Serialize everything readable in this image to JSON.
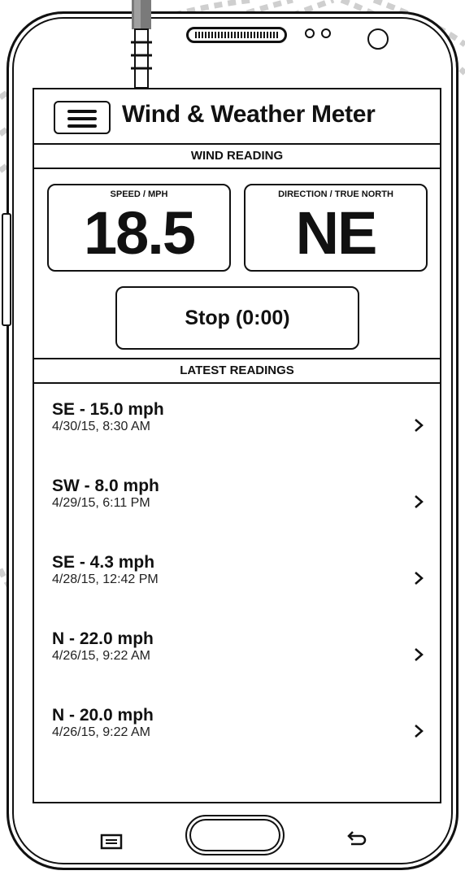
{
  "app": {
    "title": "Wind & Weather Meter"
  },
  "wind": {
    "section_title": "WIND READING",
    "speed_caption": "SPEED / MPH",
    "speed_value": "18.5",
    "direction_caption": "DIRECTION / TRUE NORTH",
    "direction_value": "NE"
  },
  "stop_button": {
    "label": "Stop (0:00)"
  },
  "latest": {
    "section_title": "LATEST READINGS",
    "items": [
      {
        "main": "SE - 15.0 mph",
        "sub": "4/30/15, 8:30 AM"
      },
      {
        "main": "SW - 8.0 mph",
        "sub": "4/29/15, 6:11 PM"
      },
      {
        "main": "SE - 4.3 mph",
        "sub": "4/28/15, 12:42 PM"
      },
      {
        "main": "N - 22.0 mph",
        "sub": "4/26/15, 9:22 AM"
      },
      {
        "main": "N - 20.0 mph",
        "sub": "4/26/15, 9:22 AM"
      }
    ]
  },
  "icons": {
    "menu": "hamburger-menu-icon",
    "row_chevron": "chevron-right-icon",
    "recents": "recent-apps-icon",
    "back": "back-arrow-icon"
  },
  "colors": {
    "ink": "#111111",
    "background": "#ffffff",
    "decor": "#cfcfcf"
  }
}
